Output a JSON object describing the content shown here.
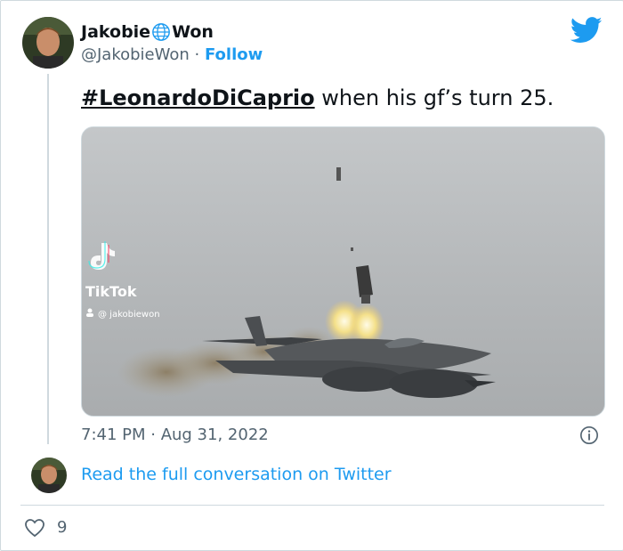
{
  "tweet": {
    "author_first": "Jakobie",
    "author_last": "Won",
    "handle": "@JakobieWon",
    "separator": " · ",
    "follow_label": "Follow",
    "hashtag": "#LeonardoDiCaprio",
    "text_rest": " when his gf’s turn 25.",
    "timestamp": "7:41 PM · Aug 31, 2022",
    "read_more_label": "Read the full conversation on Twitter",
    "like_count": "9"
  },
  "media": {
    "watermark_brand": "TikTok",
    "watermark_user": "@ jakobiewon"
  },
  "icons": {
    "globe": "globe-icon",
    "twitter": "twitter-bird-icon",
    "info": "info-icon",
    "heart": "heart-icon"
  },
  "colors": {
    "accent": "#1d9bf0",
    "text": "#0f1419",
    "muted": "#536471",
    "border": "#cfd9de"
  }
}
